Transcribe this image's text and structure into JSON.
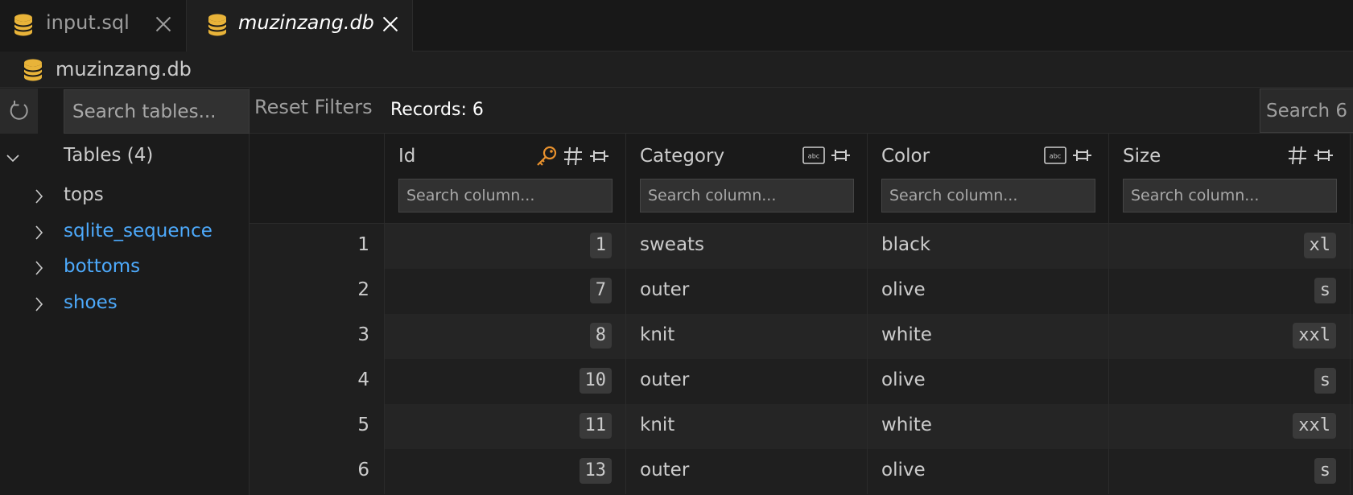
{
  "tabs": [
    {
      "label": "input.sql",
      "active": false
    },
    {
      "label": "muzinzang.db",
      "active": true
    }
  ],
  "breadcrumb": {
    "label": "muzinzang.db"
  },
  "sidebar": {
    "search_placeholder": "Search tables...",
    "tables_title": "Tables (4)",
    "items": [
      {
        "label": "tops",
        "color": "#cccccc"
      },
      {
        "label": "sqlite_sequence",
        "color": "#4daafc"
      },
      {
        "label": "bottoms",
        "color": "#4daafc"
      },
      {
        "label": "shoes",
        "color": "#4daafc"
      }
    ]
  },
  "toolbar": {
    "reset_label": "Reset Filters",
    "records_label": "Records: 6",
    "search_label": "Search 6"
  },
  "grid": {
    "filter_placeholder": "Search column...",
    "columns": [
      {
        "title": "Id",
        "icons": [
          "key-icon",
          "hash-icon",
          "pin-icon"
        ]
      },
      {
        "title": "Category",
        "icons": [
          "abc-icon",
          "pin-icon"
        ]
      },
      {
        "title": "Color",
        "icons": [
          "abc-icon",
          "pin-icon"
        ]
      },
      {
        "title": "Size",
        "icons": [
          "hash-icon",
          "pin-icon"
        ]
      }
    ],
    "rows": [
      {
        "n": "1",
        "id": "1",
        "category": "sweats",
        "color": "black",
        "size": "xl"
      },
      {
        "n": "2",
        "id": "7",
        "category": "outer",
        "color": "olive",
        "size": "s"
      },
      {
        "n": "3",
        "id": "8",
        "category": "knit",
        "color": "white",
        "size": "xxl"
      },
      {
        "n": "4",
        "id": "10",
        "category": "outer",
        "color": "olive",
        "size": "s"
      },
      {
        "n": "5",
        "id": "11",
        "category": "knit",
        "color": "white",
        "size": "xxl"
      },
      {
        "n": "6",
        "id": "13",
        "category": "outer",
        "color": "olive",
        "size": "s"
      }
    ]
  },
  "colors": {
    "db_icon": "#e8b339",
    "key_icon": "#e8912d",
    "link_blue": "#4daafc"
  }
}
